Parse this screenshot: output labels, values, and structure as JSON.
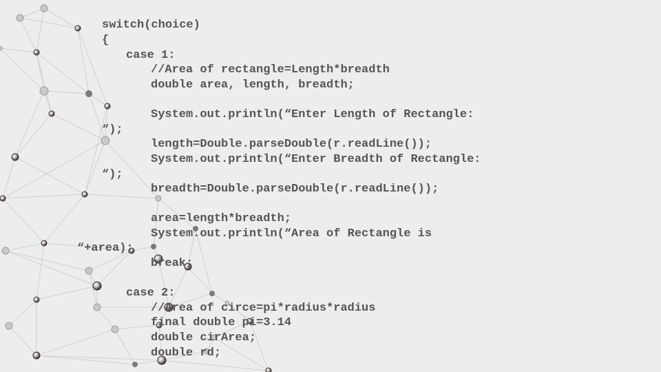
{
  "slide": {
    "background": "#ededed",
    "code_color": "#555555",
    "network_line_color": "#c8c8c8",
    "code_lines": [
      "switch(choice)",
      "{",
      "case 1:",
      "//Area of rectangle=Length*breadth",
      "double area, length, breadth;",
      "System.out.println(“Enter Length of Rectangle:",
      "“);",
      "length=Double.parseDouble(r.readLine());",
      "System.out.println(“Enter Breadth of Rectangle:",
      "“);",
      "breadth=Double.parseDouble(r.readLine());",
      "area=length*breadth;",
      "System.out.println(“Area of Rectangle is",
      "“+area);",
      "break;",
      "case 2:",
      "//Area of circe=pi*radius*radius",
      "final double pi=3.14",
      "double cirArea;",
      "double rd;"
    ]
  }
}
